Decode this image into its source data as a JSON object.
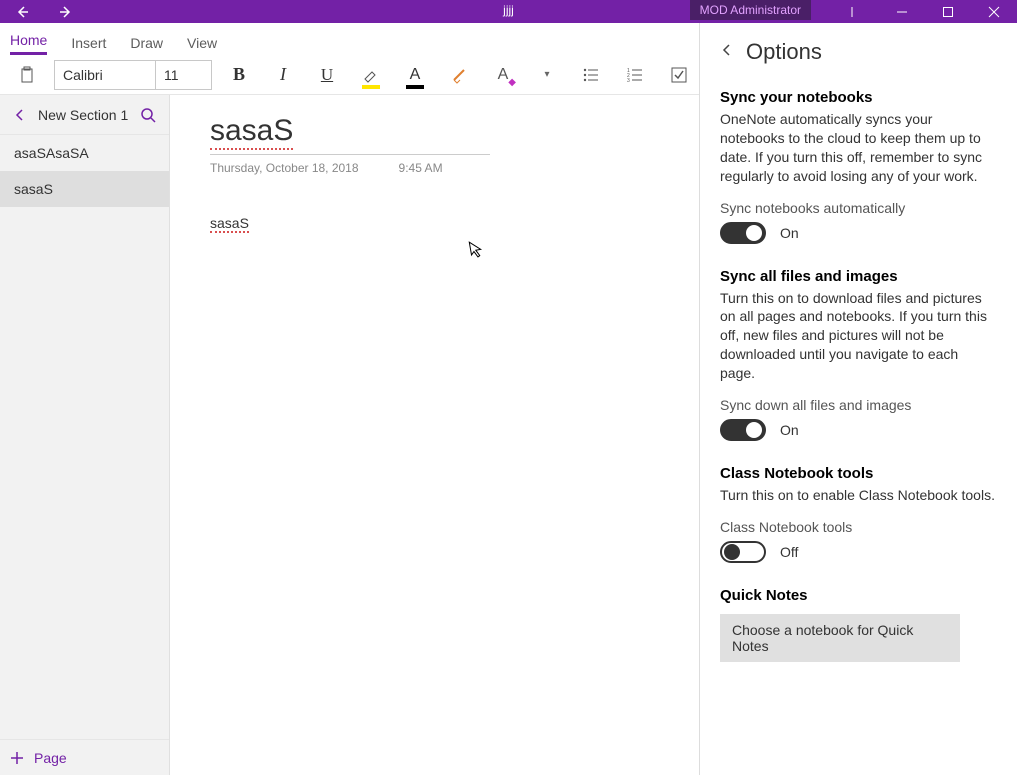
{
  "titlebar": {
    "app_title": "jjjj",
    "user_label": "MOD Administrator"
  },
  "ribbon": {
    "tabs": [
      "Home",
      "Insert",
      "Draw",
      "View"
    ],
    "active_tab_index": 0
  },
  "toolbar": {
    "font_name": "Calibri",
    "font_size": "11"
  },
  "page_list": {
    "section_name": "New Section 1",
    "pages": [
      {
        "title": "asaSAsaSA",
        "selected": false
      },
      {
        "title": "sasaS",
        "selected": true
      }
    ],
    "add_page_label": "Page"
  },
  "note": {
    "title": "sasaS",
    "date": "Thursday, October 18, 2018",
    "time": "9:45 AM",
    "body": "sasaS"
  },
  "options": {
    "panel_title": "Options",
    "sections": {
      "sync_notebooks": {
        "heading": "Sync your notebooks",
        "text": "OneNote automatically syncs your notebooks to the cloud to keep them up to date. If you turn this off, remember to sync regularly to avoid losing any of your work.",
        "toggle_label": "Sync notebooks automatically",
        "toggle_state": "On",
        "toggle_on": true
      },
      "sync_files": {
        "heading": "Sync all files and images",
        "text": "Turn this on to download files and pictures on all pages and notebooks. If you turn this off, new files and pictures will not be downloaded until you navigate to each page.",
        "toggle_label": "Sync down all files and images",
        "toggle_state": "On",
        "toggle_on": true
      },
      "class_notebook": {
        "heading": "Class Notebook tools",
        "text": "Turn this on to enable Class Notebook tools.",
        "toggle_label": "Class Notebook tools",
        "toggle_state": "Off",
        "toggle_on": false
      },
      "quick_notes": {
        "heading": "Quick Notes",
        "button_label": "Choose a notebook for Quick Notes"
      }
    }
  }
}
